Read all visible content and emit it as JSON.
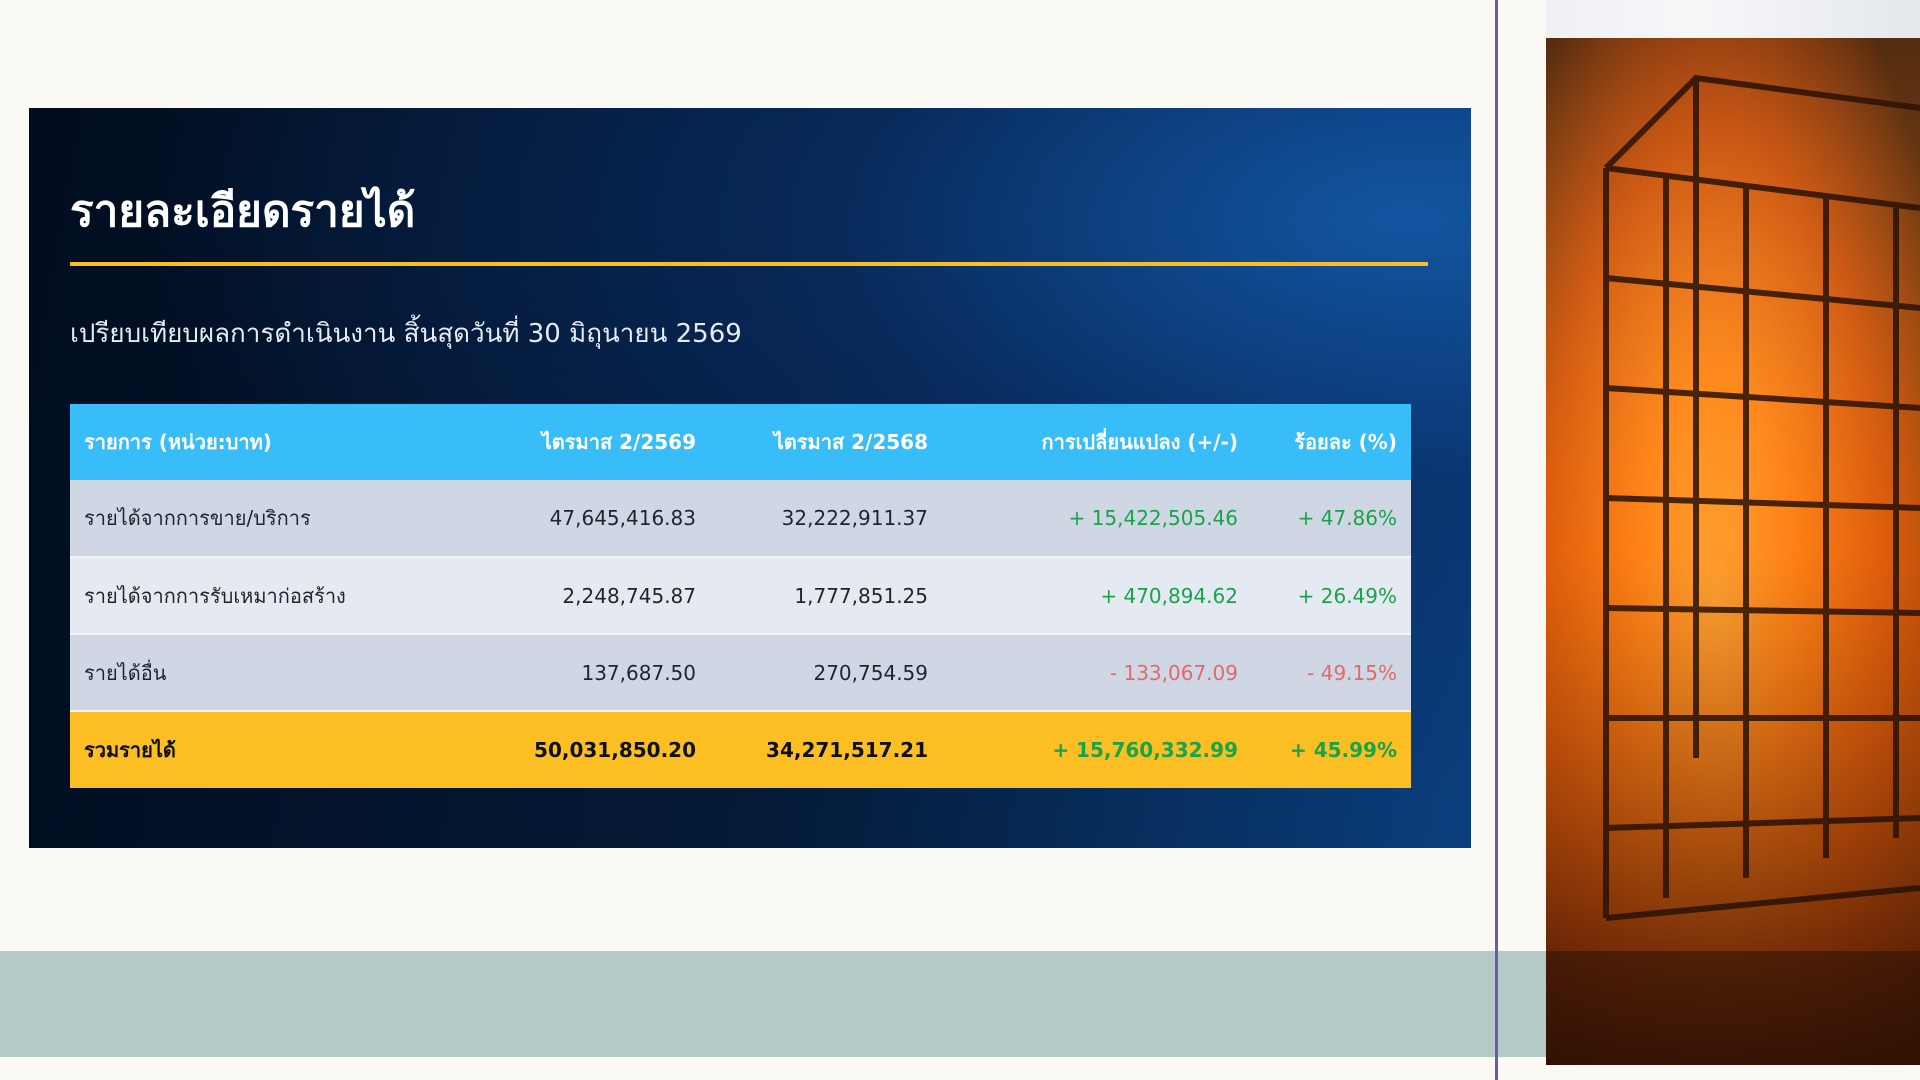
{
  "report": {
    "title": "รายละเอียดรายได้",
    "subtitle": "เปรียบเทียบผลการดำเนินงาน สิ้นสุดวันที่ 30 มิถุนายน 2569"
  },
  "table": {
    "headers": [
      "รายการ (หน่วย:บาท)",
      "ไตรมาส 2/2569",
      "ไตรมาส 2/2568",
      "การเปลี่ยนแปลง (+/-)",
      "ร้อยละ (%)"
    ],
    "rows": [
      {
        "label": "รายได้จากการขาย/บริการ",
        "q2_2569": "47,645,416.83",
        "q2_2568": "32,222,911.37",
        "change": "+ 15,422,505.46",
        "percent": "+ 47.86%"
      },
      {
        "label": "รายได้จากการรับเหมาก่อสร้าง",
        "q2_2569": "2,248,745.87",
        "q2_2568": "1,777,851.25",
        "change": "+ 470,894.62",
        "percent": "+ 26.49%"
      },
      {
        "label": "รายได้อื่น",
        "q2_2569": "137,687.50",
        "q2_2568": "270,754.59",
        "change": "- 133,067.09",
        "percent": "- 49.15%"
      }
    ],
    "total": {
      "label": "รวมรายได้",
      "q2_2569": "50,031,850.20",
      "q2_2568": "34,271,517.21",
      "change": "+ 15,760,332.99",
      "percent": "+ 45.99%"
    }
  },
  "colors": {
    "accent_gold": "#fbbd24",
    "header_blue": "#38bdf8",
    "positive": "#1aa34a",
    "negative": "#e06a6a"
  },
  "image": {
    "subject": "burning-building-photo-icon"
  }
}
